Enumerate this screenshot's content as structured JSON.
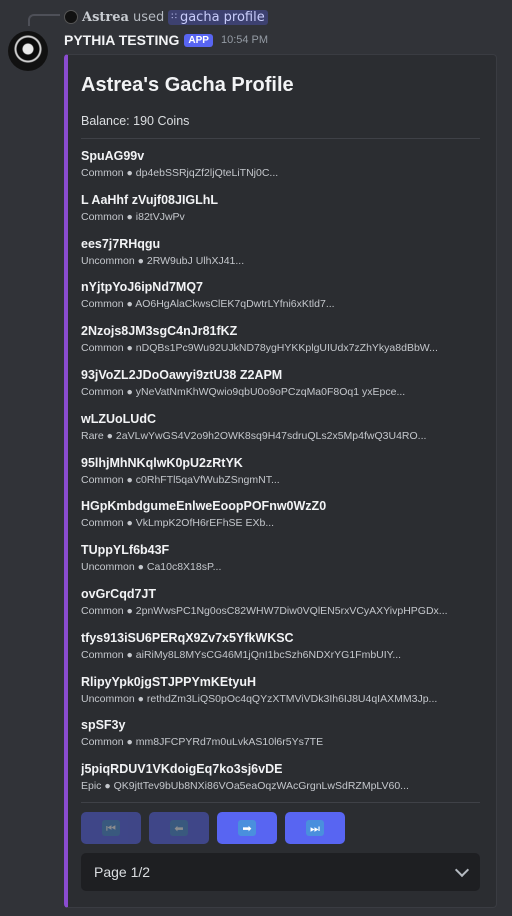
{
  "reply": {
    "user": "Astrea",
    "action": "used",
    "command": "gacha profile"
  },
  "bot": {
    "name": "PYTHIA TESTING",
    "badge": "APP",
    "time": "10:54 PM"
  },
  "embed": {
    "accent_color": "#8a4cd0",
    "title": "Astrea's Gacha Profile",
    "balance": "Balance: 190 Coins",
    "items": [
      {
        "name": "SpuAG99v",
        "desc": "Common ● dp4ebSSRjqZf2ljQteLiTNj0C..."
      },
      {
        "name": "L AaHhf zVujf08JIGLhL",
        "desc": "Common ● i82tVJwPv"
      },
      {
        "name": "ees7j7RHqgu",
        "desc": "Uncommon ● 2RW9ubJ UlhXJ41..."
      },
      {
        "name": "nYjtpYoJ6ipNd7MQ7",
        "desc": "Common ● AO6HgAlaCkwsClEK7qDwtrLYfni6xKtld7..."
      },
      {
        "name": "2Nzojs8JM3sgC4nJr81fKZ",
        "desc": "Common ● nDQBs1Pc9Wu92UJkND78ygHYKKplgUIUdx7zZhYkya8dBbW..."
      },
      {
        "name": "93jVoZL2JDoOawyi9ztU38 Z2APM",
        "desc": "Common ● yNeVatNmKhWQwio9qbU0o9oPCzqMa0F8Oq1 yxEpce..."
      },
      {
        "name": "wLZUoLUdC",
        "desc": "Rare ● 2aVLwYwGS4V2o9h2OWK8sq9H47sdruQLs2x5Mp4fwQ3U4RO..."
      },
      {
        "name": "95lhjMhNKqlwK0pU2zRtYK",
        "desc": "Common ● c0RhFTl5qaVfWubZSngmNT..."
      },
      {
        "name": "HGpKmbdgumeEnlweEoopPOFnw0WzZ0",
        "desc": "Common ● VkLmpK2OfH6rEFhSE EXb..."
      },
      {
        "name": "TUppYLf6b43F",
        "desc": "Uncommon ● Ca10c8X18sP..."
      },
      {
        "name": "ovGrCqd7JT",
        "desc": "Common ● 2pnWwsPC1Ng0osC82WHW7Diw0VQlEN5rxVCyAXYivpHPGDx..."
      },
      {
        "name": "tfys913iSU6PERqX9Zv7x5YfkWKSC",
        "desc": "Common ● aiRiMy8L8MYsCG46M1jQnI1bcSzh6NDXrYG1FmbUIY..."
      },
      {
        "name": "RlipyYpk0jgSTJPPYmKEtyuH",
        "desc": "Uncommon ● rethdZm3LiQS0pOc4qQYzXTMViVDk3Ih6IJ8U4qIAXMM3Jp..."
      },
      {
        "name": "spSF3y",
        "desc": "Common ● mm8JFCPYRd7m0uLvkAS10l6r5Ys7TE"
      },
      {
        "name": "j5piqRDUV1VKdoigEq7ko3sj6vDE",
        "desc": "Epic ● QK9jttTev9bUb8NXi86VOa5eaOqzWAcGrgnLwSdRZMpLV60..."
      }
    ]
  },
  "buttons": {
    "first": "⏮",
    "prev": "⬅",
    "next": "➡",
    "last": "⏭"
  },
  "select": {
    "value": "Page 1/2"
  }
}
